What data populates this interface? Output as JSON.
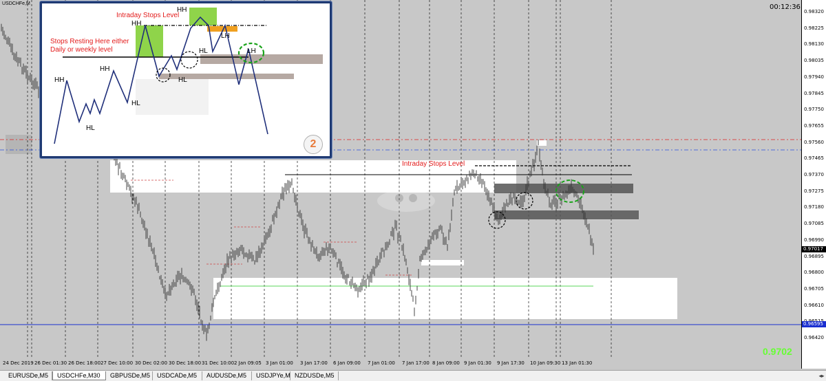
{
  "window": {
    "symbol_title": "USDCHFe,M",
    "clock": "00:12:36",
    "current_price_big": "0.9702"
  },
  "price_axis": {
    "labels": [
      "0.98320",
      "0.98225",
      "0.98130",
      "0.98035",
      "0.97940",
      "0.97845",
      "0.97750",
      "0.97655",
      "0.97560",
      "0.97465",
      "0.97370",
      "0.97275",
      "0.97180",
      "0.97085",
      "0.96990",
      "0.96895",
      "0.96800",
      "0.96705",
      "0.96610",
      "0.96515",
      "0.96420"
    ],
    "current_box": "0.97017",
    "blue_box": "0.96595"
  },
  "time_axis": {
    "labels": [
      "24 Dec 2019",
      "26 Dec 01:30",
      "26 Dec 18:00",
      "27 Dec 10:00",
      "30 Dec 02:00",
      "30 Dec 18:00",
      "31 Dec 10:00",
      "2 Jan 09:05",
      "3 Jan 01:00",
      "3 Jan 17:00",
      "6 Jan 09:00",
      "7 Jan 01:00",
      "7 Jan 17:00",
      "8 Jan 09:00",
      "9 Jan 01:30",
      "9 Jan 17:30",
      "10 Jan 09:30",
      "13 Jan 01:30"
    ]
  },
  "tabs": [
    {
      "label": "EURUSDe,M5",
      "active": false
    },
    {
      "label": "USDCHFe,M30",
      "active": true
    },
    {
      "label": "GBPUSDe,M5",
      "active": false
    },
    {
      "label": "USDCADe,M5",
      "active": false
    },
    {
      "label": "AUDUSDe,M5",
      "active": false
    },
    {
      "label": "USDJPYe,M1",
      "active": false
    },
    {
      "label": "NZDUSDe,M5",
      "active": false
    }
  ],
  "inset": {
    "intraday_label": "Intraday Stops Level",
    "stops_resting_line1": "Stops Resting Here either",
    "stops_resting_line2": "Daily or weekly level",
    "badge": "2",
    "swing_labels": {
      "hh1": "HH",
      "hl1": "HL",
      "hh2": "HH",
      "hl2": "HL",
      "hh3": "HH",
      "hl3": "HL",
      "hl4": "HL",
      "hh4": "HH",
      "lh1": "LH",
      "lh2": "LH"
    }
  },
  "chart": {
    "intraday_label": "Intraday Stops Level"
  },
  "colors": {
    "grid_bg": "#c8c8c8",
    "red_dashdot": "#e02020",
    "blue_dashdot": "#2a4fe0",
    "blue_solid": "#1a2fd0",
    "green_line": "#5ad45a",
    "accent_green": "#66ff33",
    "inset_border": "#1f3a73"
  }
}
